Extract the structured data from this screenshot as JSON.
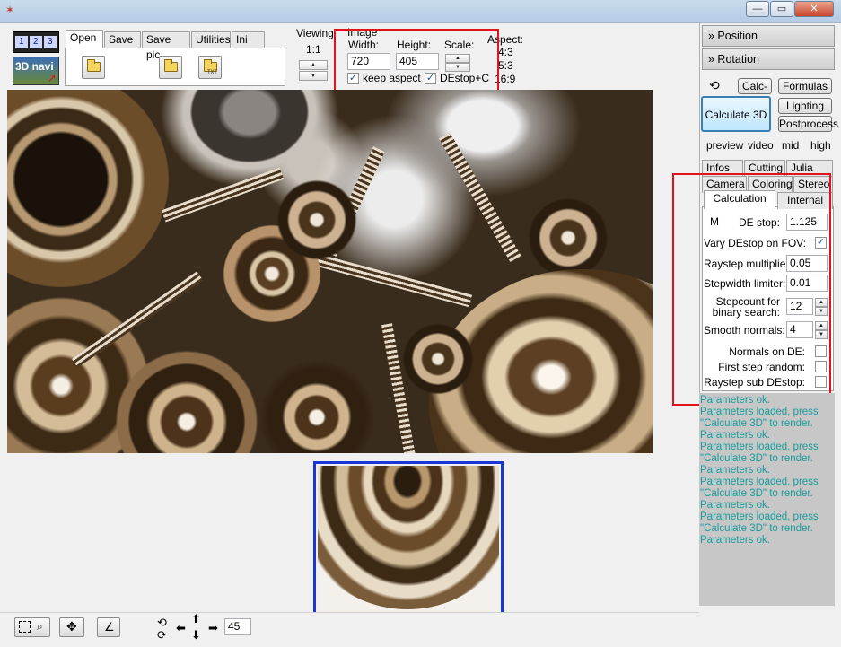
{
  "titlebar": {
    "min_label": "—",
    "max_label": "▭",
    "close_label": "✕"
  },
  "file_tabs": {
    "items": [
      "Open",
      "Save",
      "Save pic",
      "Utilities",
      "Ini"
    ]
  },
  "file_buttons": {
    "txt_sub": "TXT"
  },
  "logo": {
    "num1": "1",
    "num2": "2",
    "num3": "3",
    "navi": "3D navi"
  },
  "viewing": {
    "title": "Viewing",
    "ratio": "1:1"
  },
  "image": {
    "title": "Image",
    "width_label": "Width:",
    "width_value": "720",
    "height_label": "Height:",
    "height_value": "405",
    "scale_label": "Scale:",
    "keep_aspect_label": "keep aspect",
    "destop_label": "DEstop+C"
  },
  "aspect": {
    "title": "Aspect:",
    "options": [
      "4:3",
      "5:3",
      "16:9"
    ]
  },
  "right": {
    "position_label": "» Position",
    "rotation_label": "» Rotation",
    "undo_icon_label": "⟲",
    "calc_minus_label": "Calc-",
    "formulas_label": "Formulas",
    "calculate_label": "Calculate 3D",
    "lighting_label": "Lighting",
    "postprocess_label": "Postprocess",
    "quality": [
      "preview",
      "video",
      "mid",
      "high"
    ],
    "tabs_row1": [
      "Infos",
      "Cutting",
      "Julia On"
    ],
    "tabs_row2": [
      "Camera",
      "Coloring",
      "Stereo"
    ],
    "subtabs": [
      "Calculation",
      "Internal"
    ],
    "m_label": "M",
    "de_stop_label": "DE stop:",
    "de_stop_value": "1.125",
    "vary_label": "Vary DEstop on FOV:",
    "raystep_label": "Raystep multiplier:",
    "raystep_value": "0.05",
    "stepwidth_label": "Stepwidth limiter:",
    "stepwidth_value": "0.01",
    "stepcount_label1": "Stepcount for",
    "stepcount_label2": "binary search:",
    "stepcount_value": "12",
    "smooth_label": "Smooth  normals:",
    "smooth_value": "4",
    "normals_de_label": "Normals on DE:",
    "first_step_label": "First step random:",
    "raystep_sub_label": "Raystep sub DEstop:"
  },
  "log": {
    "lines": [
      "Parameters ok.",
      "Parameters loaded, press",
      "\"Calculate 3D\" to render.",
      "Parameters ok.",
      "Parameters loaded, press",
      "\"Calculate 3D\" to render.",
      "Parameters ok.",
      "Parameters loaded, press",
      "\"Calculate 3D\" to render.",
      "Parameters ok.",
      "Parameters loaded, press",
      "\"Calculate 3D\" to render.",
      "Parameters ok."
    ]
  },
  "bottom": {
    "angle_value": "45"
  },
  "colors": {
    "accent_red": "#e2131c",
    "accent_blue": "#1a36d6",
    "log_text": "#1b9c9c"
  }
}
